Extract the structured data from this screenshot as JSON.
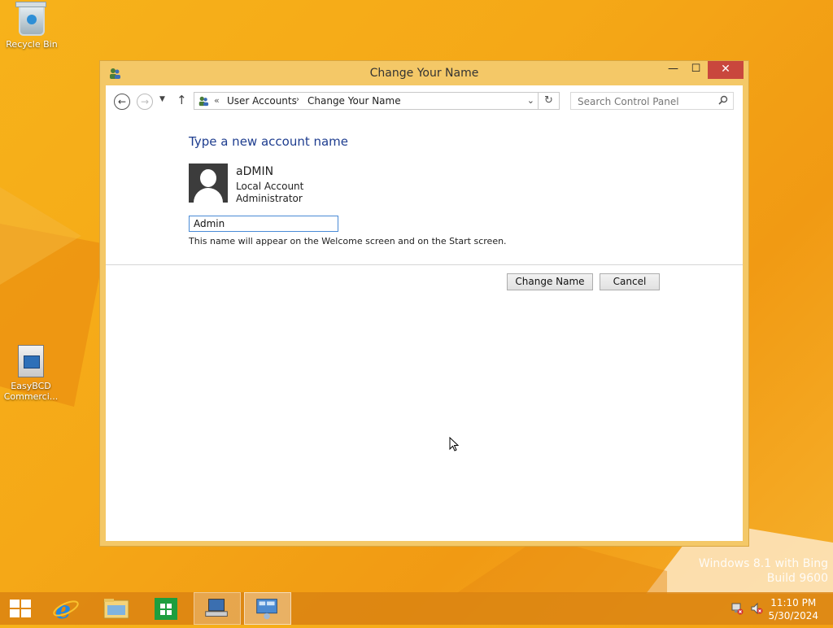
{
  "desktop": {
    "icons": [
      {
        "label": "Recycle Bin",
        "icon": "recycle-bin-icon"
      },
      {
        "label": "EasyBCD Commerci...",
        "icon": "easybcd-icon"
      }
    ],
    "watermark": {
      "line1": "Windows 8.1 with Bing",
      "line2": "Build 9600"
    }
  },
  "window": {
    "title": "Change Your Name",
    "controls": {
      "minimize": "—",
      "maximize": "☐",
      "close": "✕"
    },
    "address": {
      "chevron": "«",
      "crumbs": [
        "User Accounts",
        "Change Your Name"
      ],
      "separator": "›"
    },
    "search": {
      "placeholder": "Search Control Panel"
    },
    "content": {
      "heading": "Type a new account name",
      "user": {
        "name": "aDMIN",
        "type": "Local Account",
        "role": "Administrator"
      },
      "input_value": "Admin",
      "hint": "This name will appear on the Welcome screen and on the Start screen.",
      "buttons": {
        "change": "Change Name",
        "cancel": "Cancel"
      }
    }
  },
  "taskbar": {
    "items": [
      "start-icon",
      "internet-explorer-icon",
      "file-explorer-icon",
      "store-icon",
      "computer-app-icon",
      "control-panel-icon"
    ],
    "clock": {
      "time": "11:10 PM",
      "date": "5/30/2024"
    }
  },
  "colors": {
    "accent_heading": "#1e3d8f",
    "desktop_bg": "#f5a817",
    "window_frame": "#f4c867",
    "close_button": "#c9473d",
    "input_focus": "#4a8bd6"
  }
}
